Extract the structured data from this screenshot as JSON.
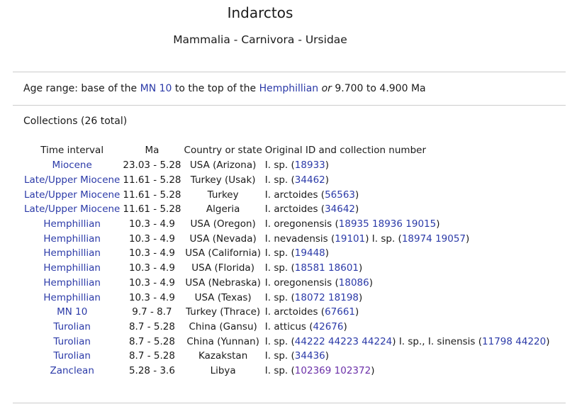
{
  "title": "Indarctos",
  "taxonomy": "Mammalia - Carnivora - Ursidae",
  "age_range": {
    "prefix": "Age range: base of the ",
    "from_link": "MN 10",
    "middle": " to the top of the ",
    "to_link": "Hemphillian",
    "or": "or",
    "values": " 9.700 to 4.900 Ma"
  },
  "collections_heading": "Collections (26 total)",
  "table": {
    "headers": [
      "Time interval",
      "Ma",
      "Country or state",
      "Original ID and collection number"
    ],
    "rows": [
      {
        "interval": "Miocene",
        "ma": "23.03 - 5.28",
        "country": "USA (Arizona)",
        "ids": [
          {
            "text": "I. sp. (",
            "links": [
              "18933"
            ],
            "suffix": ")"
          }
        ]
      },
      {
        "interval": "Late/Upper Miocene",
        "ma": "11.61 - 5.28",
        "country": "Turkey (Usak)",
        "ids": [
          {
            "text": "I. sp. (",
            "links": [
              "34462"
            ],
            "suffix": ")"
          }
        ]
      },
      {
        "interval": "Late/Upper Miocene",
        "ma": "11.61 - 5.28",
        "country": "Turkey",
        "ids": [
          {
            "text": "I. arctoides (",
            "links": [
              "56563"
            ],
            "suffix": ")"
          }
        ]
      },
      {
        "interval": "Late/Upper Miocene",
        "ma": "11.61 - 5.28",
        "country": "Algeria",
        "ids": [
          {
            "text": "I. arctoides (",
            "links": [
              "34642"
            ],
            "suffix": ")"
          }
        ]
      },
      {
        "interval": "Hemphillian",
        "ma": "10.3 - 4.9",
        "country": "USA (Oregon)",
        "ids": [
          {
            "text": "I. oregonensis (",
            "links": [
              "18935",
              "18936",
              "19015"
            ],
            "suffix": ")"
          }
        ]
      },
      {
        "interval": "Hemphillian",
        "ma": "10.3 - 4.9",
        "country": "USA (Nevada)",
        "ids": [
          {
            "text": "I. nevadensis (",
            "links": [
              "19101"
            ],
            "suffix": ")"
          },
          {
            "text": " I. sp. (",
            "links": [
              "18974",
              "19057"
            ],
            "suffix": ")"
          }
        ]
      },
      {
        "interval": "Hemphillian",
        "ma": "10.3 - 4.9",
        "country": "USA (California)",
        "ids": [
          {
            "text": "I. sp. (",
            "links": [
              "19448"
            ],
            "suffix": ")"
          }
        ]
      },
      {
        "interval": "Hemphillian",
        "ma": "10.3 - 4.9",
        "country": "USA (Florida)",
        "ids": [
          {
            "text": "I. sp. (",
            "links": [
              "18581",
              "18601"
            ],
            "suffix": ")"
          }
        ]
      },
      {
        "interval": "Hemphillian",
        "ma": "10.3 - 4.9",
        "country": "USA (Nebraska)",
        "ids": [
          {
            "text": "I. oregonensis (",
            "links": [
              "18086"
            ],
            "suffix": ")"
          }
        ]
      },
      {
        "interval": "Hemphillian",
        "ma": "10.3 - 4.9",
        "country": "USA (Texas)",
        "ids": [
          {
            "text": "I. sp. (",
            "links": [
              "18072",
              "18198"
            ],
            "suffix": ")"
          }
        ]
      },
      {
        "interval": "MN 10",
        "ma": "9.7 - 8.7",
        "country": "Turkey (Thrace)",
        "ids": [
          {
            "text": "I. arctoides (",
            "links": [
              "67661"
            ],
            "suffix": ")"
          }
        ]
      },
      {
        "interval": "Turolian",
        "ma": "8.7 - 5.28",
        "country": "China (Gansu)",
        "ids": [
          {
            "text": "I. atticus (",
            "links": [
              "42676"
            ],
            "suffix": ")"
          }
        ]
      },
      {
        "interval": "Turolian",
        "ma": "8.7 - 5.28",
        "country": "China (Yunnan)",
        "ids": [
          {
            "text": "I. sp. (",
            "links": [
              "44222",
              "44223",
              "44224"
            ],
            "suffix": ")"
          },
          {
            "text": " I. sp., I. sinensis (",
            "links": [
              "11798",
              "44220"
            ],
            "suffix": ")"
          }
        ]
      },
      {
        "interval": "Turolian",
        "ma": "8.7 - 5.28",
        "country": "Kazakstan",
        "ids": [
          {
            "text": "I. sp. (",
            "links": [
              "34436"
            ],
            "suffix": ")"
          }
        ]
      },
      {
        "interval": "Zanclean",
        "ma": "5.28 - 3.6",
        "country": "Libya",
        "ids": [
          {
            "text": "I. sp. (",
            "links": [
              "102369",
              "102372"
            ],
            "suffix": ")",
            "visited": true
          }
        ]
      }
    ]
  },
  "colors": {
    "link": "#2b3aa8",
    "visited_link": "#6b2fa8",
    "rule": "#cccccc"
  }
}
